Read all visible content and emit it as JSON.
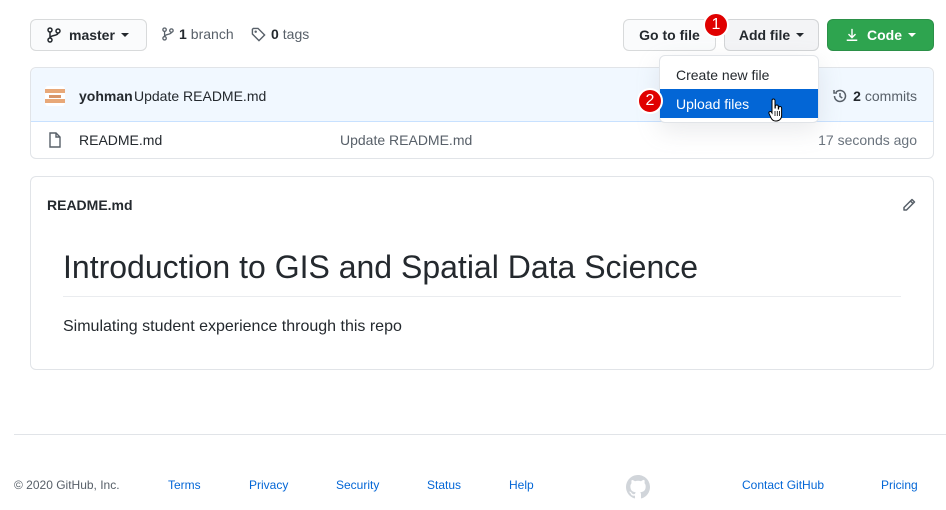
{
  "toolbar": {
    "branch_name": "master",
    "branch_count": "1",
    "branch_label": "branch",
    "tag_count": "0",
    "tag_label": "tags",
    "go_to_file": "Go to file",
    "add_file": "Add file",
    "code": "Code"
  },
  "annotations": {
    "step1": "1",
    "step2": "2"
  },
  "add_file_menu": {
    "items": [
      {
        "label": "Create new file"
      },
      {
        "label": "Upload files"
      }
    ]
  },
  "latest_commit": {
    "user": "yohman",
    "message": "Update README.md",
    "commit_count": "2",
    "commit_label": "commits"
  },
  "files": [
    {
      "name": "README.md",
      "commit_message": "Update README.md",
      "age": "17 seconds ago"
    }
  ],
  "readme": {
    "file_label": "README.md",
    "heading": "Introduction to GIS and Spatial Data Science",
    "paragraph": "Simulating student experience through this repo"
  },
  "footer": {
    "copyright": "© 2020 GitHub, Inc.",
    "links": [
      "Terms",
      "Privacy",
      "Security",
      "Status",
      "Help",
      "Contact GitHub",
      "Pricing"
    ]
  },
  "colors": {
    "primary_green": "#2ea44f",
    "link_blue": "#0366d6",
    "badge_red": "#e00000",
    "commit_row_bg": "#f1f8ff"
  },
  "icons": [
    "git-branch-icon",
    "tag-icon",
    "download-icon",
    "history-icon",
    "file-icon",
    "pencil-icon",
    "github-logo-icon",
    "hand-cursor-icon"
  ]
}
